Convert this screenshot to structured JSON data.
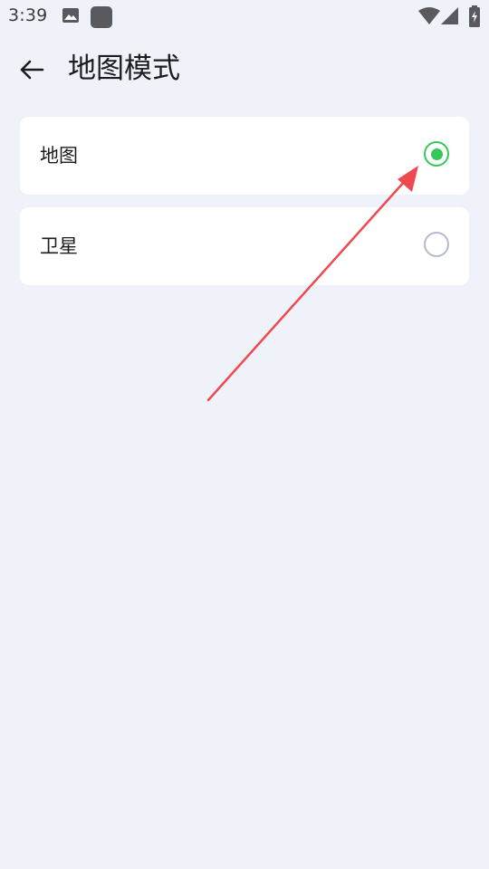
{
  "status_bar": {
    "time": "3:39",
    "icons": [
      "image-icon",
      "app-icon",
      "wifi-icon",
      "cell-signal-icon",
      "battery-charging-icon"
    ]
  },
  "app_bar": {
    "back_icon": "arrow-left-icon",
    "title": "地图模式"
  },
  "options": [
    {
      "label": "地图",
      "selected": true
    },
    {
      "label": "卫星",
      "selected": false
    }
  ],
  "colors": {
    "background": "#eff2f9",
    "card": "#ffffff",
    "accent": "#34c759",
    "radio_unselected": "#b5b9cc",
    "annotation": "#f0484f"
  }
}
